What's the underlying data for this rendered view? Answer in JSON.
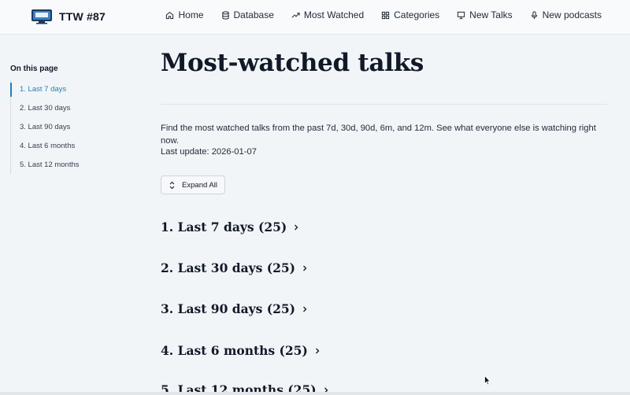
{
  "header": {
    "brand": "TTW #87",
    "nav": [
      {
        "label": "Home",
        "icon": "home-icon"
      },
      {
        "label": "Database",
        "icon": "database-icon"
      },
      {
        "label": "Most Watched",
        "icon": "trending-icon"
      },
      {
        "label": "Categories",
        "icon": "grid-icon"
      },
      {
        "label": "New Talks",
        "icon": "presentation-icon"
      },
      {
        "label": "New podcasts",
        "icon": "microphone-icon"
      }
    ]
  },
  "toc": {
    "title": "On this page",
    "items": [
      {
        "label": "1. Last 7 days",
        "active": true
      },
      {
        "label": "2. Last 30 days",
        "active": false
      },
      {
        "label": "3. Last 90 days",
        "active": false
      },
      {
        "label": "4. Last 6 months",
        "active": false
      },
      {
        "label": "5. Last 12 months",
        "active": false
      }
    ]
  },
  "main": {
    "title": "Most-watched talks",
    "intro": "Find the most watched talks from the past 7d, 30d, 90d, 6m, and 12m. See what everyone else is watching right now.",
    "last_update": "Last update: 2026-01-07",
    "expand_label": "Expand All",
    "sections": [
      {
        "label": "1. Last 7 days (25)"
      },
      {
        "label": "2. Last 30 days (25)"
      },
      {
        "label": "3. Last 90 days (25)"
      },
      {
        "label": "4. Last 6 months (25)"
      },
      {
        "label": "5. Last 12 months (25)"
      }
    ]
  },
  "colors": {
    "accent": "#1f7fb8",
    "background": "#f1f5f8",
    "text": "#111827"
  }
}
